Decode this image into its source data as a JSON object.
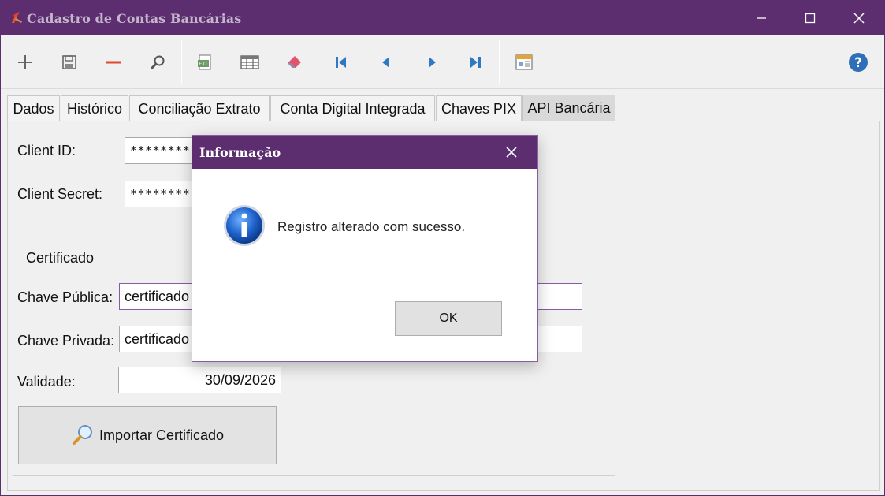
{
  "window": {
    "title": "Cadastro de Contas Bancárias",
    "titlebar_color": "#5c2d6f"
  },
  "toolbar": {
    "buttons": [
      {
        "name": "add",
        "icon": "plus-icon"
      },
      {
        "name": "save",
        "icon": "save-icon"
      },
      {
        "name": "delete",
        "icon": "minus-icon"
      },
      {
        "name": "search",
        "icon": "search-icon"
      },
      {
        "name": "export-excel",
        "icon": "excel-icon"
      },
      {
        "name": "grid",
        "icon": "table-icon"
      },
      {
        "name": "clear",
        "icon": "eraser-icon"
      },
      {
        "name": "first",
        "icon": "first-record-icon"
      },
      {
        "name": "previous",
        "icon": "previous-record-icon"
      },
      {
        "name": "next",
        "icon": "next-record-icon"
      },
      {
        "name": "last",
        "icon": "last-record-icon"
      },
      {
        "name": "report",
        "icon": "report-icon"
      },
      {
        "name": "help",
        "icon": "help-icon"
      }
    ]
  },
  "tabs": [
    {
      "label": "Dados",
      "active": false
    },
    {
      "label": "Histórico",
      "active": false
    },
    {
      "label": "Conciliação Extrato",
      "active": false
    },
    {
      "label": "Conta Digital Integrada",
      "active": false
    },
    {
      "label": "Chaves PIX",
      "active": false
    },
    {
      "label": "API Bancária",
      "active": true
    }
  ],
  "form": {
    "client_id_label": "Client ID:",
    "client_id_value": "********",
    "client_secret_label": "Client Secret:",
    "client_secret_value": "********",
    "certificate_group_label": "Certificado",
    "public_key_label": "Chave Pública:",
    "public_key_value": "certificado",
    "private_key_label": "Chave Privada:",
    "private_key_value": "certificado",
    "validity_label": "Validade:",
    "validity_value": "30/09/2026",
    "import_button_label": "Importar Certificado"
  },
  "dialog": {
    "title": "Informação",
    "message": "Registro alterado com sucesso.",
    "ok_label": "OK"
  }
}
